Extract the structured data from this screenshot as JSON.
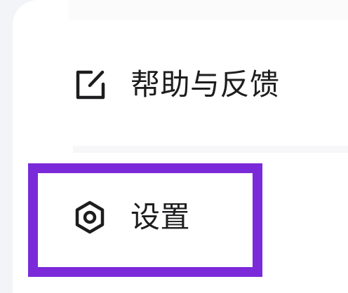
{
  "menu": {
    "items": [
      {
        "label": "帮助与反馈",
        "icon": "edit-feedback-icon"
      },
      {
        "label": "设置",
        "icon": "settings-hexagon-icon"
      }
    ]
  },
  "colors": {
    "highlight": "#7b2ad9",
    "text": "#1d1d1f",
    "panel": "#ffffff",
    "background": "#f3f4f7"
  }
}
